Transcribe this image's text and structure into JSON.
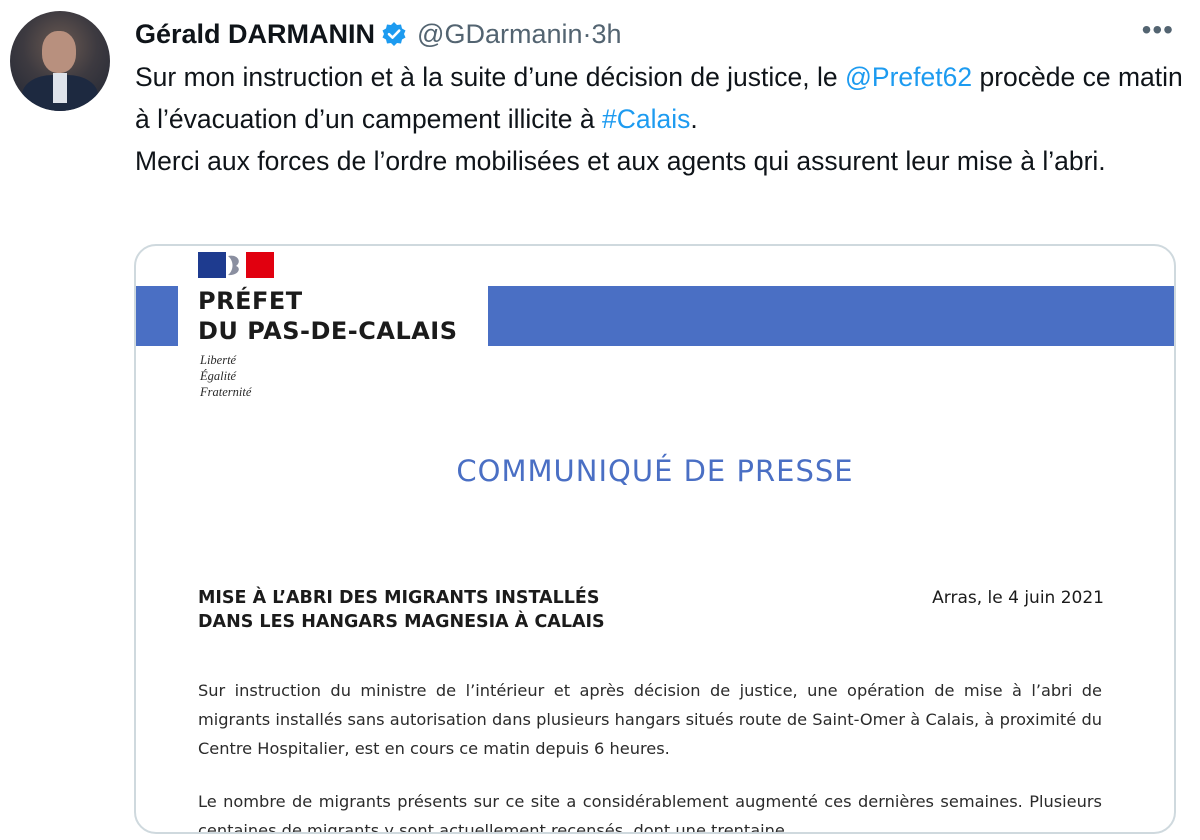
{
  "tweet": {
    "author_name": "Gérald DARMANIN",
    "handle": "@GDarmanin",
    "separator": " · ",
    "time": "3h",
    "more_glyph": "•••",
    "text_1": "Sur mon instruction et à la suite d’une décision de justice, le ",
    "mention": "@Prefet62",
    "text_2": " procède ce matin à l’évacuation d’un campement illicite à ",
    "hashtag": "#Calais",
    "text_3": ".",
    "text_4": "Merci aux forces de l’ordre mobilisées et aux agents qui assurent leur mise à l’abri."
  },
  "document": {
    "prefet_line1": "PRÉFET",
    "prefet_line2": "DU PAS-DE-CALAIS",
    "devise_1": "Liberté",
    "devise_2": "Égalité",
    "devise_3": "Fraternité",
    "title": "COMMUNIQUÉ DE PRESSE",
    "headline_1": "MISE À L’ABRI DES MIGRANTS INSTALLÉS",
    "headline_2": "DANS LES HANGARS MAGNESIA À CALAIS",
    "date": "Arras, le 4 juin 2021",
    "paragraph_1": "Sur instruction du ministre de l’intérieur et après décision de justice, une opération de mise à l’abri de migrants installés sans autorisation dans plusieurs hangars situés route de Saint-Omer à Calais, à proximité du Centre Hospitalier, est en cours ce matin depuis 6 heures.",
    "paragraph_2": "Le nombre de migrants présents sur ce site a considérablement augmenté ces dernières semaines. Plusieurs centaines de migrants y sont actuellement recensés, dont une trentaine"
  },
  "colors": {
    "link": "#1d9bf0",
    "verified": "#1d9bf0",
    "prefecture_blue": "#4a6fc4",
    "flag_red": "#e1000f"
  },
  "icons": {
    "verified": "verified-badge-icon",
    "more": "more-options-icon",
    "marianne": "marianne-logo"
  }
}
